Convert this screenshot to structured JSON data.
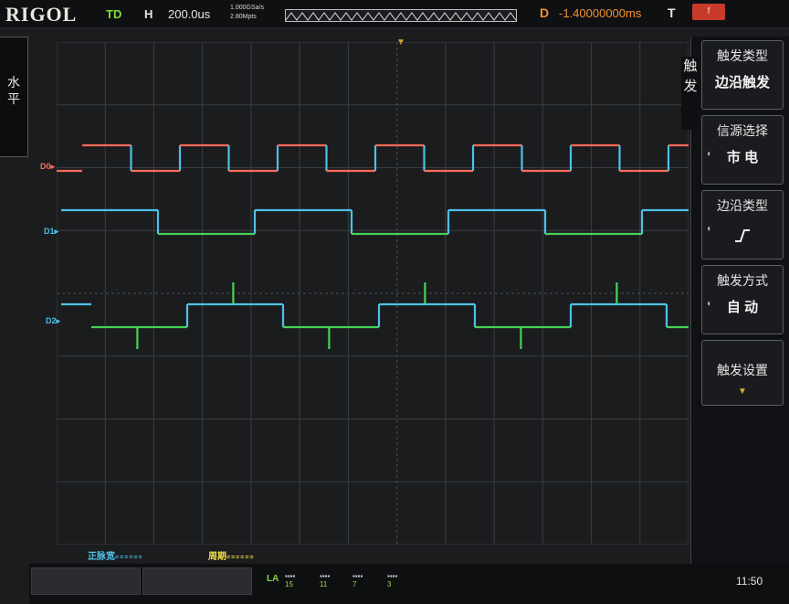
{
  "header": {
    "brand": "RIGOL",
    "run_state": "TD",
    "timebase_label": "H",
    "timebase_value": "200.0us",
    "sample_rate": "1.000GSa/s",
    "memory_depth": "2.80Mpts",
    "delay_label": "D",
    "delay_value": "-1.40000000ms",
    "trigger_label": "T",
    "trigger_badge": "f"
  },
  "left_panel": {
    "label": "水平"
  },
  "menu": {
    "title": "触发",
    "items": [
      {
        "title": "触发类型",
        "value": "边沿触发"
      },
      {
        "title": "信源选择",
        "value": "市 电"
      },
      {
        "title": "边沿类型",
        "value": "rising-edge-icon"
      },
      {
        "title": "触发方式",
        "value": "自 动"
      },
      {
        "title": "触发设置",
        "value": "▼"
      }
    ]
  },
  "channels": [
    {
      "label": "D0",
      "color": "#ff6a5a"
    },
    {
      "label": "D1",
      "color": "#4ec0e6"
    },
    {
      "label": "D2",
      "color": "#4ec0e6"
    }
  ],
  "measurements": [
    {
      "label": "正脉宽",
      "value": "======",
      "color": "#4ec0e6"
    },
    {
      "label": "周期",
      "value": "======",
      "color": "#f0e04a"
    }
  ],
  "bottom": {
    "la_label": "LA",
    "la_groups": [
      "15",
      "11",
      "7",
      "3"
    ],
    "clock": "11:50"
  },
  "colors": {
    "d0": "#ff6a5a",
    "high": "#4ec0e6",
    "low": "#47d05a",
    "grid": "#3b3e41",
    "trigger": "#e0a83a"
  },
  "icons": {
    "edge": "rising-edge-icon",
    "trigger_marker": "trigger-position-icon",
    "memory_strip": "memory-strip-icon"
  }
}
